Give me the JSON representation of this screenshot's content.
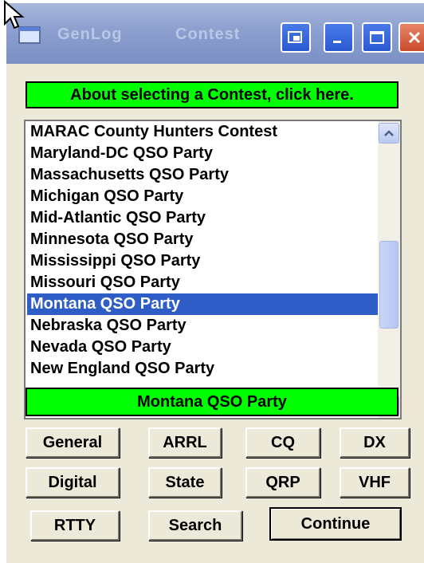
{
  "window": {
    "title_left": "GenLog",
    "title_right": "Contest"
  },
  "about_bar": "About selecting a Contest, click here.",
  "contests": [
    "MARAC County Hunters Contest",
    "Maryland-DC QSO Party",
    "Massachusetts QSO Party",
    "Michigan QSO Party",
    "Mid-Atlantic QSO Party",
    "Minnesota QSO Party",
    "Mississippi QSO Party",
    "Missouri QSO Party",
    "Montana QSO Party",
    "Nebraska QSO Party",
    "Nevada QSO Party",
    "New England QSO Party"
  ],
  "selected_index": 8,
  "selected_contest": "Montana QSO Party",
  "buttons": {
    "general": "General",
    "arrl": "ARRL",
    "cq": "CQ",
    "dx": "DX",
    "digital": "Digital",
    "state": "State",
    "qrp": "QRP",
    "vhf": "VHF",
    "rtty": "RTTY",
    "search": "Search",
    "continue": "Continue"
  },
  "colors": {
    "green_bar": "#00ff00",
    "selection": "#2f5dc7",
    "window_bg": "#ece9d8"
  }
}
